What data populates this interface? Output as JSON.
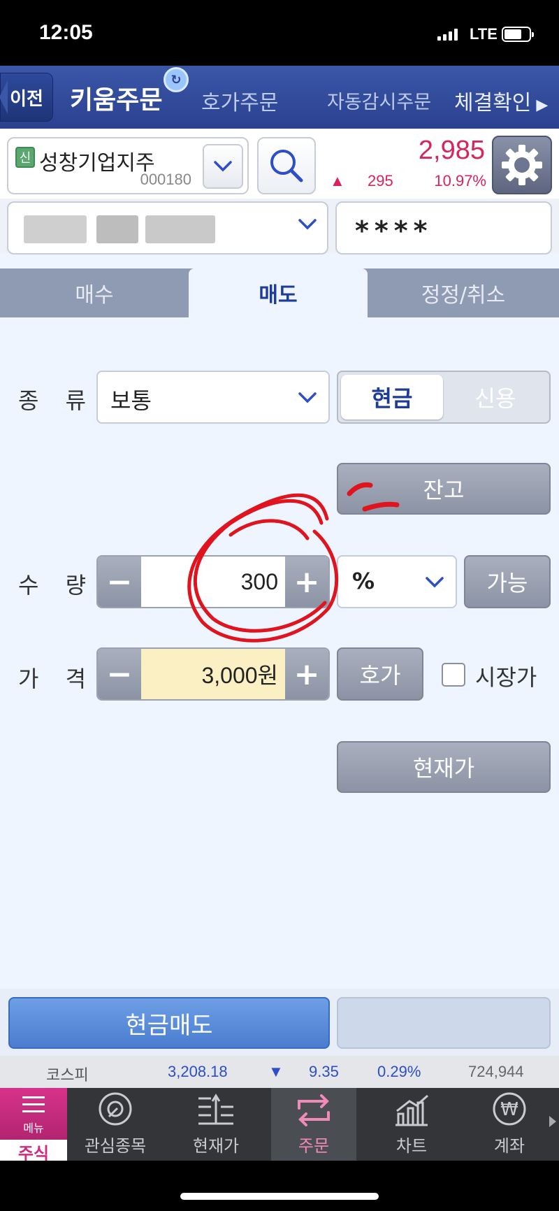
{
  "status": {
    "time": "12:05",
    "network": "LTE"
  },
  "header": {
    "back": "이전",
    "tabs": [
      "키움주문",
      "호가주문",
      "자동감시주문",
      "체결확인"
    ]
  },
  "stock": {
    "badge": "신",
    "name": "성창기업지주",
    "code": "000180",
    "price": "2,985",
    "change": "295",
    "change_pct": "10.97%",
    "direction_icon": "triangle-up-icon"
  },
  "account": {
    "password": "****"
  },
  "order_tabs": [
    "매수",
    "매도",
    "정정/취소"
  ],
  "form": {
    "type_label": "종 류",
    "type_value": "보통",
    "cash": "현금",
    "credit": "신용",
    "balance_button": "잔고",
    "qty_label": "수 량",
    "qty_value": "300",
    "qty_unit": "%",
    "available_button": "가능",
    "price_label": "가 격",
    "price_value": "3,000원",
    "quote_button": "호가",
    "market_price_label": "시장가",
    "current_price_button": "현재가"
  },
  "action": {
    "sell_button": "현금매도"
  },
  "ticker": {
    "index": "코스피",
    "value": "3,208.18",
    "change": "9.35",
    "pct": "0.29%",
    "volume": "724,944"
  },
  "bottom_nav": {
    "menu": "메뉴",
    "stock": "주식",
    "items": [
      "관심종목",
      "현재가",
      "주문",
      "차트",
      "계좌"
    ]
  },
  "colors": {
    "up": "#d9245b",
    "down": "#2d4ec7",
    "brand": "#2a418f",
    "annotation": "#e0141e"
  }
}
